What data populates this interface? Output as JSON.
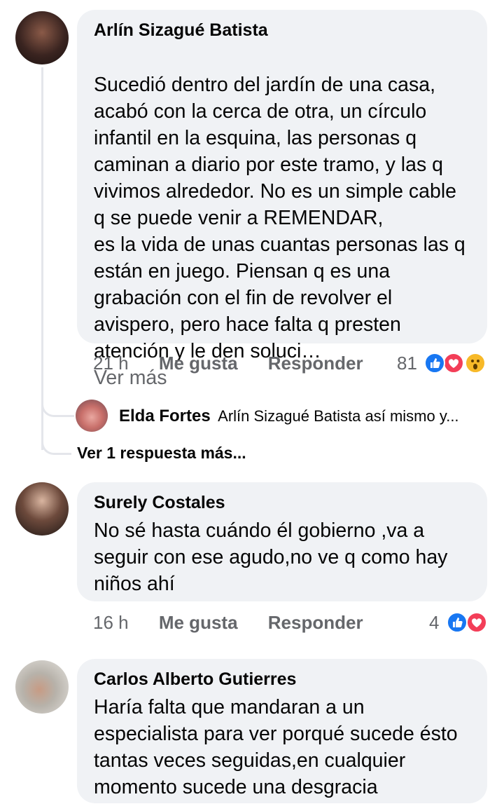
{
  "colors": {
    "bubble": "#f0f2f5",
    "secondary_text": "#65676b",
    "like_blue": "#1877f2",
    "love_red": "#f33e58",
    "wow_yellow": "#f7b928"
  },
  "comments": [
    {
      "author": "Arlín Sizagué Batista",
      "text": "Sucedió dentro del jardín de una casa, acabó con la cerca de otra, un círculo infantil en la esquina, las personas q caminan a diario por este tramo, y las q vivimos alrededor. No es un simple cable q se puede venir a REMENDAR,\nes la vida de unas cuantas personas las q están en juego. Piensan q es una grabación con el fin de revolver el avispero, pero hace falta q presten atención y le den soluci…",
      "see_more": "Ver más",
      "time": "21 h",
      "like_label": "Me gusta",
      "reply_label": "Responder",
      "reaction_count": "81",
      "reactions": [
        "like-icon",
        "love-icon",
        "wow-icon"
      ],
      "reply_preview": {
        "author": "Elda Fortes",
        "text": "Arlín Sizagué Batista así mismo y..."
      },
      "more_replies": "Ver 1 respuesta más..."
    },
    {
      "author": "Surely Costales",
      "text": "No sé hasta cuándo él gobierno ,va a seguir con ese agudo,no ve q como hay niños ahí",
      "time": "16 h",
      "like_label": "Me gusta",
      "reply_label": "Responder",
      "reaction_count": "4",
      "reactions": [
        "like-icon",
        "love-icon"
      ]
    },
    {
      "author": "Carlos Alberto Gutierres",
      "text": "Haría falta que mandaran a un especialista para ver porqué sucede ésto tantas veces seguidas,en cualquier momento sucede una desgracia"
    }
  ]
}
